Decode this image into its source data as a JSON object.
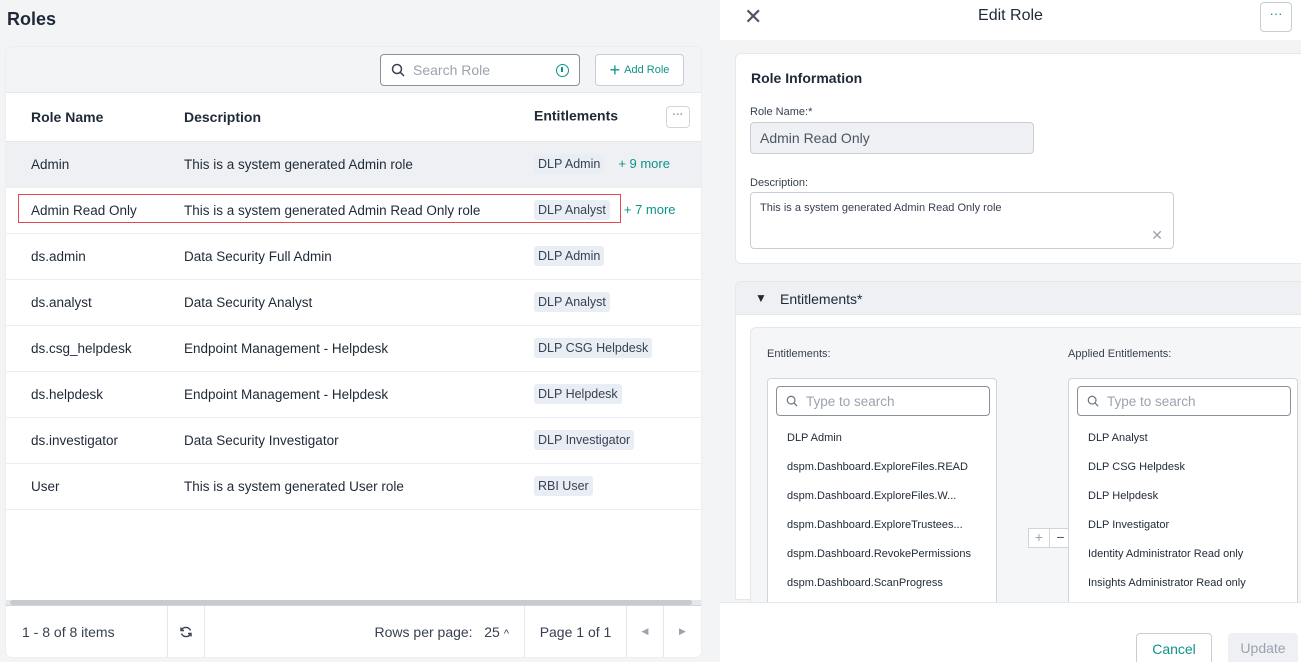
{
  "roles": {
    "title": "Roles",
    "search": {
      "placeholder": "Search Role"
    },
    "add_button": "Add Role",
    "columns": [
      "Role Name",
      "Description",
      "Entitlements"
    ],
    "rows": [
      {
        "name": "Admin",
        "description": "This is a system generated Admin role",
        "tag": "DLP Admin",
        "more": "+ 9 more"
      },
      {
        "name": "Admin Read Only",
        "description": "This is a system generated Admin Read Only role",
        "tag": "DLP Analyst",
        "more": "+ 7 more"
      },
      {
        "name": "ds.admin",
        "description": "Data Security Full Admin",
        "tag": "DLP Admin",
        "more": ""
      },
      {
        "name": "ds.analyst",
        "description": "Data Security Analyst",
        "tag": "DLP Analyst",
        "more": ""
      },
      {
        "name": "ds.csg_helpdesk",
        "description": "Endpoint Management - Helpdesk",
        "tag": "DLP CSG Helpdesk",
        "more": ""
      },
      {
        "name": "ds.helpdesk",
        "description": "Endpoint Management - Helpdesk",
        "tag": "DLP Helpdesk",
        "more": ""
      },
      {
        "name": "ds.investigator",
        "description": "Data Security Investigator",
        "tag": "DLP Investigator",
        "more": ""
      },
      {
        "name": "User",
        "description": "This is a system generated User role",
        "tag": "RBI User",
        "more": ""
      }
    ],
    "footer": {
      "items": "1 - 8 of 8 items",
      "rows_per_page_label": "Rows per page:",
      "rows_per_page": "25",
      "page": "Page 1 of 1"
    }
  },
  "edit_role": {
    "title": "Edit Role",
    "section_title": "Role Information",
    "role_name_label": "Role Name:*",
    "role_name_value": "Admin Read Only",
    "description_label": "Description:",
    "description_value": "This is a system generated Admin Read Only role",
    "entitlements_section": "Entitlements*",
    "available_label": "Entitlements:",
    "applied_label": "Applied Entitlements:",
    "search_placeholder": "Type to search",
    "available": [
      "DLP Admin",
      "dspm.Dashboard.ExploreFiles.READ",
      "dspm.Dashboard.ExploreFiles.W...",
      "dspm.Dashboard.ExploreTrustees...",
      "dspm.Dashboard.RevokePermissions",
      "dspm.Dashboard.ScanProgress"
    ],
    "applied": [
      "DLP Analyst",
      "DLP CSG Helpdesk",
      "DLP Helpdesk",
      "DLP Investigator",
      "Identity Administrator Read only",
      "Insights Administrator Read only"
    ],
    "cancel": "Cancel",
    "update": "Update"
  },
  "colors": {
    "accent": "#0d9488",
    "selection_outline": "#e5484d"
  }
}
